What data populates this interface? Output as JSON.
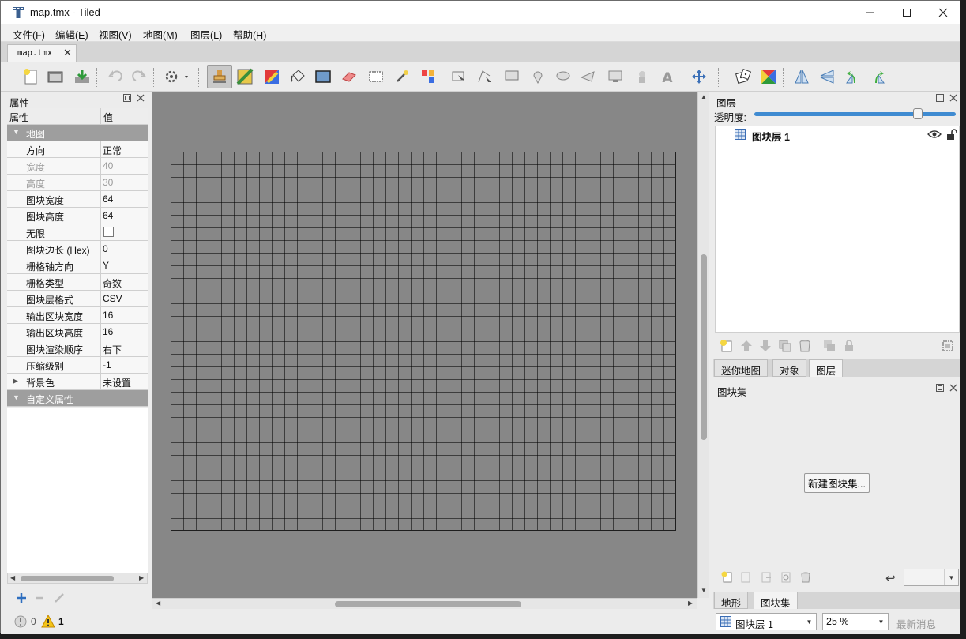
{
  "window": {
    "title": "map.tmx - Tiled",
    "minimize_icon": "minimize-icon",
    "maximize_icon": "maximize-icon",
    "close_icon": "close-icon"
  },
  "menu": [
    "文件(F)",
    "编辑(E)",
    "视图(V)",
    "地图(M)",
    "图层(L)",
    "帮助(H)"
  ],
  "tabs": {
    "document": "map.tmx",
    "close_glyph": "✕"
  },
  "toolbar": {
    "tools": [
      "new-map-icon",
      "open-icon",
      "save-icon",
      "undo-icon",
      "redo-icon",
      "commands-icon",
      "stamp-brush-icon",
      "terrain-brush-icon",
      "wang-brush-icon",
      "bucket-fill-icon",
      "shape-fill-icon",
      "eraser-icon",
      "rectangle-select-icon",
      "magic-wand-icon",
      "select-same-tile-icon",
      "select-objects-icon",
      "edit-polygons-icon",
      "insert-rectangle-icon",
      "insert-point-icon",
      "insert-ellipse-icon",
      "insert-polygon-icon",
      "insert-tile-icon",
      "insert-template-icon",
      "insert-text-icon",
      "move-icon",
      "random-mode-icon",
      "wang-fill-icon",
      "flip-horizontal-icon",
      "flip-vertical-icon",
      "rotate-left-icon",
      "rotate-right-icon"
    ],
    "active_tool": "stamp-brush-icon"
  },
  "properties": {
    "title": "属性",
    "header": {
      "key": "属性",
      "value": "值"
    },
    "map_group": "地图",
    "rows": [
      {
        "key": "方向",
        "value": "正常",
        "dim": false
      },
      {
        "key": "宽度",
        "value": "40",
        "dim": true
      },
      {
        "key": "高度",
        "value": "30",
        "dim": true
      },
      {
        "key": "图块宽度",
        "value": "64",
        "dim": false
      },
      {
        "key": "图块高度",
        "value": "64",
        "dim": false
      },
      {
        "key": "无限",
        "value": "",
        "dim": false,
        "checkbox": true
      },
      {
        "key": "图块边长 (Hex)",
        "value": "0",
        "dim": false
      },
      {
        "key": "栅格轴方向",
        "value": "Y",
        "dim": false
      },
      {
        "key": "栅格类型",
        "value": "奇数",
        "dim": false
      },
      {
        "key": "图块层格式",
        "value": "CSV",
        "dim": false
      },
      {
        "key": "输出区块宽度",
        "value": "16",
        "dim": false
      },
      {
        "key": "输出区块高度",
        "value": "16",
        "dim": false
      },
      {
        "key": "图块渲染顺序",
        "value": "右下",
        "dim": false
      },
      {
        "key": "压缩级别",
        "value": "-1",
        "dim": false
      },
      {
        "key": "背景色",
        "value": "未设置",
        "dim": false,
        "collapsed": true
      }
    ],
    "custom_group": "自定义属性",
    "add_icon": "add-property-icon",
    "remove_icon": "remove-property-icon",
    "rename_icon": "rename-property-icon"
  },
  "status": {
    "errors": "0",
    "warnings": "1"
  },
  "layers": {
    "title": "图层",
    "opacity_label": "透明度:",
    "opacity": 1.0,
    "items": [
      {
        "name": "图块层 1",
        "visible": true,
        "locked": false
      }
    ],
    "tabs": [
      "迷你地图",
      "对象",
      "图层"
    ],
    "active_tab": "图层"
  },
  "tilesets": {
    "title": "图块集",
    "new_button": "新建图块集...",
    "tabs": [
      "地形",
      "图块集"
    ],
    "active_tab": "图块集"
  },
  "bottom": {
    "layer_select": "图块层 1",
    "zoom": "25 %",
    "news": "最新消息"
  },
  "map": {
    "columns": 40,
    "rows": 30
  }
}
